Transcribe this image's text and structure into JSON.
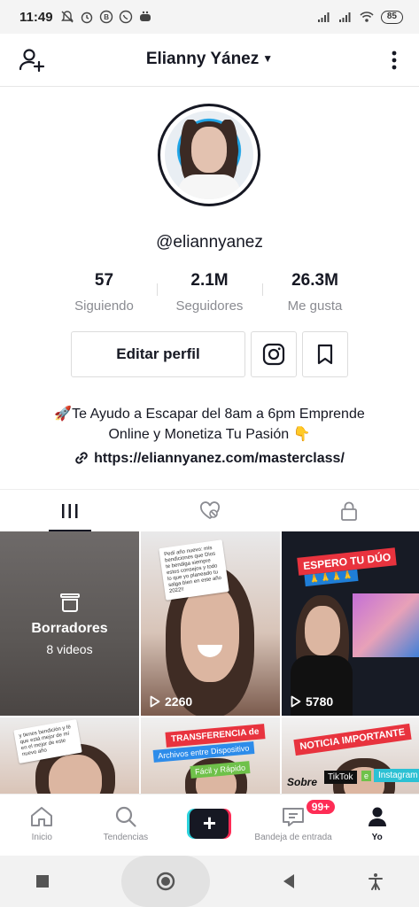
{
  "status_bar": {
    "time": "11:49",
    "battery": "85"
  },
  "header": {
    "title": "Elianny Yánez"
  },
  "profile": {
    "username": "@eliannyanez",
    "stats": [
      {
        "value": "57",
        "label": "Siguiendo"
      },
      {
        "value": "2.1M",
        "label": "Seguidores"
      },
      {
        "value": "26.3M",
        "label": "Me gusta"
      }
    ],
    "edit_button": "Editar perfil",
    "bio_line1": "🚀Te Ayudo a Escapar del 8am a 6pm Emprende",
    "bio_line2": "Online y Monetiza Tu Pasión 👇",
    "link": "https://eliannyanez.com/masterclass/"
  },
  "grid": {
    "drafts_title": "Borradores",
    "drafts_count": "8 videos",
    "video1_plays": "2260",
    "video2_plays": "5780",
    "video2_tag": "ESPERO TU DÚO",
    "video2_emojis": "🙏🙏🙏🙏",
    "video1_note": "Pedí año nuevo: mis bendiciones que Dios te bendiga siempre estos consejos y todo lo que yo planeado tu salga bien en este año 2022!!",
    "video3_note": "y tienes bendición y fé que está mejor de mí en el mejor de este nuevo año",
    "video4_tag1": "TRANSFERENCIA de",
    "video4_tag2": "Archivos entre Dispositivo",
    "video4_tag3": "Fácil y Rápido",
    "video5_tag1": "NOTICIA IMPORTANTE",
    "video5_sobre": "Sobre",
    "video5_tiktok": "TikTok",
    "video5_and": "e",
    "video5_instagram": "Instagram"
  },
  "bottom_nav": {
    "items": [
      {
        "label": "Inicio"
      },
      {
        "label": "Tendencias"
      },
      {
        "label": ""
      },
      {
        "label": "Bandeja de entrada"
      },
      {
        "label": "Yo"
      }
    ],
    "inbox_badge": "99+"
  },
  "colors": {
    "accent": "#fe2c55",
    "text": "#161823",
    "muted": "#8a8b91"
  }
}
